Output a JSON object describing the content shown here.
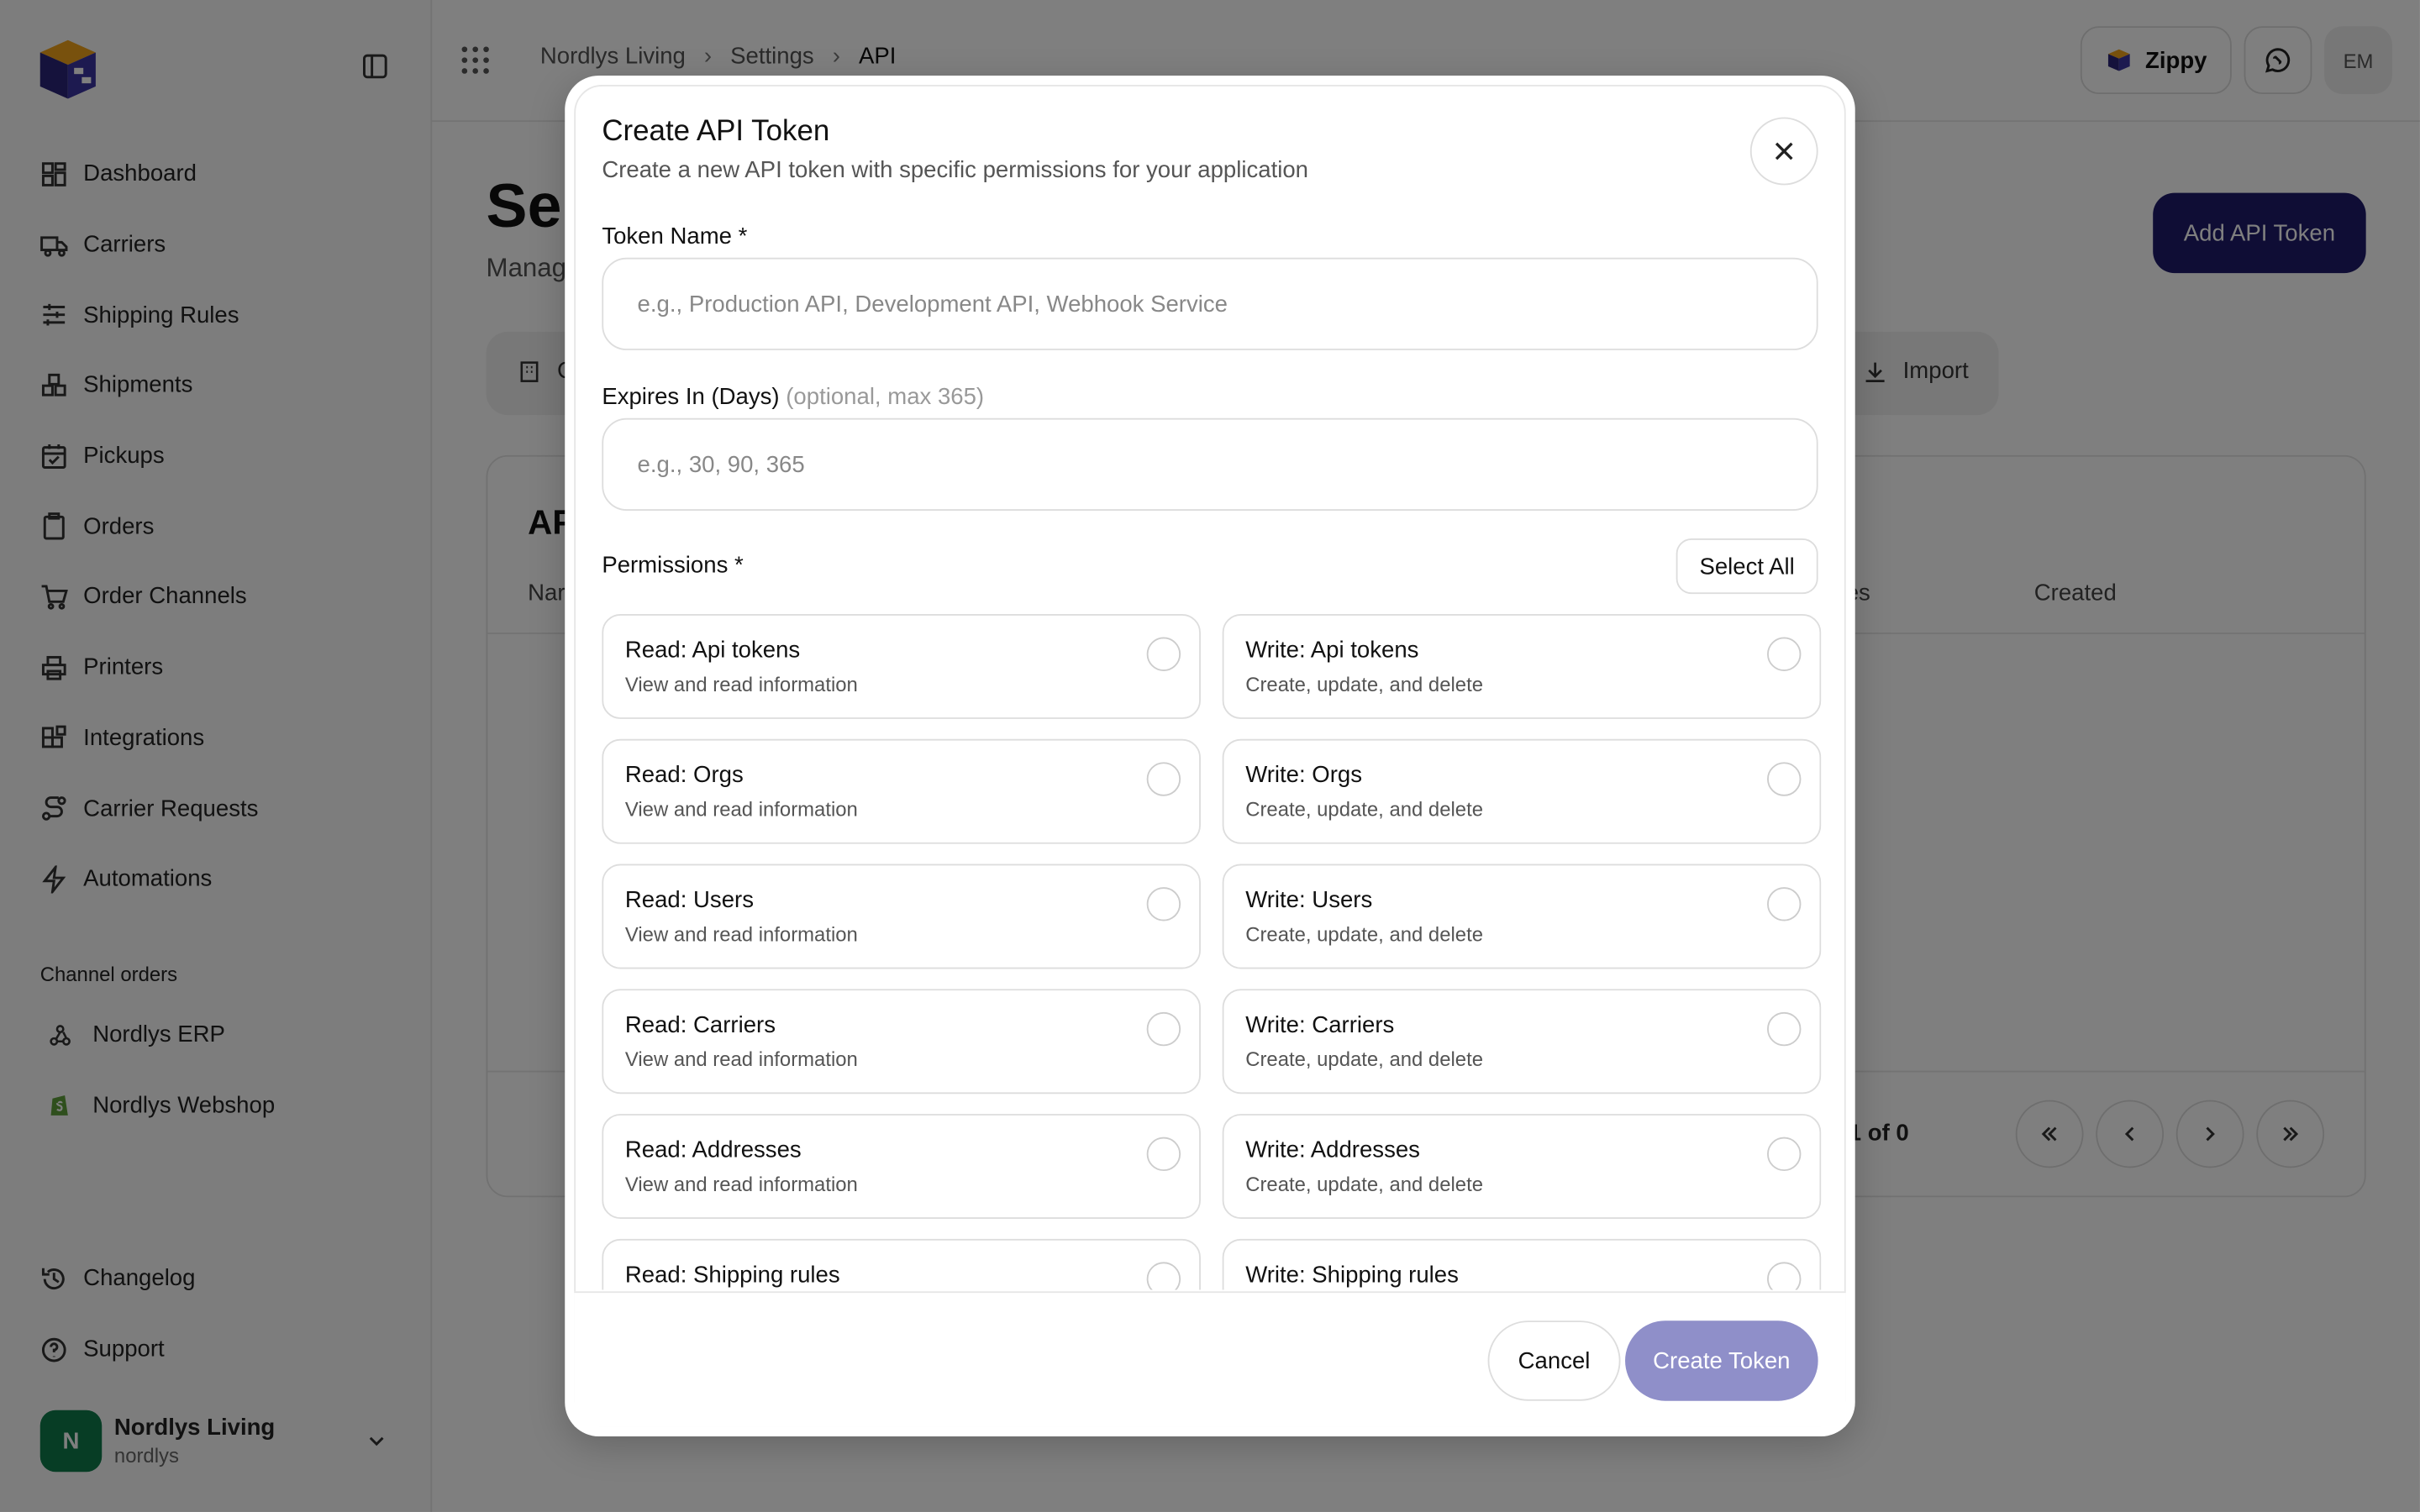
{
  "sidebar": {
    "items": [
      {
        "label": "Dashboard",
        "icon": "dashboard-icon"
      },
      {
        "label": "Carriers",
        "icon": "truck-icon"
      },
      {
        "label": "Shipping Rules",
        "icon": "sliders-icon"
      },
      {
        "label": "Shipments",
        "icon": "boxes-icon"
      },
      {
        "label": "Pickups",
        "icon": "calendar-icon"
      },
      {
        "label": "Orders",
        "icon": "clipboard-icon"
      },
      {
        "label": "Order Channels",
        "icon": "cart-icon"
      },
      {
        "label": "Printers",
        "icon": "printer-icon"
      },
      {
        "label": "Integrations",
        "icon": "blocks-icon"
      },
      {
        "label": "Carrier Requests",
        "icon": "route-icon"
      },
      {
        "label": "Automations",
        "icon": "zap-icon"
      }
    ],
    "channel_section_title": "Channel orders",
    "channels": [
      {
        "label": "Nordlys ERP",
        "icon": "webhook-icon"
      },
      {
        "label": "Nordlys Webshop",
        "icon": "shopify-icon"
      }
    ],
    "bottom_items": [
      {
        "label": "Changelog",
        "icon": "history-icon"
      },
      {
        "label": "Support",
        "icon": "help-icon"
      }
    ],
    "account": {
      "initial": "N",
      "name": "Nordlys Living",
      "slug": "nordlys"
    }
  },
  "header": {
    "breadcrumbs": [
      "Nordlys Living",
      "Settings",
      "API"
    ],
    "zippy_label": "Zippy",
    "user_initials": "EM"
  },
  "page": {
    "title": "Se",
    "subtitle": "Manag",
    "add_token_label": "Add API Token",
    "tab_first_partial": "C",
    "import_label": "Import",
    "table_title": "AP",
    "col_name_partial": "Nar",
    "col_expires_partial": "es",
    "col_created": "Created",
    "page_info_partial": "ge 1 of 0"
  },
  "modal": {
    "title": "Create API Token",
    "subtitle": "Create a new API token with specific permissions for your application",
    "token_name_label": "Token Name *",
    "token_name_placeholder": "e.g., Production API, Development API, Webhook Service",
    "token_name_value": "",
    "expires_label": "Expires In (Days)",
    "expires_hint": "(optional, max 365)",
    "expires_placeholder": "e.g., 30, 90, 365",
    "expires_value": "",
    "permissions_label": "Permissions *",
    "select_all_label": "Select All",
    "permissions": [
      {
        "title": "Read: Api tokens",
        "desc": "View and read information"
      },
      {
        "title": "Write: Api tokens",
        "desc": "Create, update, and delete"
      },
      {
        "title": "Read: Orgs",
        "desc": "View and read information"
      },
      {
        "title": "Write: Orgs",
        "desc": "Create, update, and delete"
      },
      {
        "title": "Read: Users",
        "desc": "View and read information"
      },
      {
        "title": "Write: Users",
        "desc": "Create, update, and delete"
      },
      {
        "title": "Read: Carriers",
        "desc": "View and read information"
      },
      {
        "title": "Write: Carriers",
        "desc": "Create, update, and delete"
      },
      {
        "title": "Read: Addresses",
        "desc": "View and read information"
      },
      {
        "title": "Write: Addresses",
        "desc": "Create, update, and delete"
      },
      {
        "title": "Read: Shipping rules",
        "desc": ""
      },
      {
        "title": "Write: Shipping rules",
        "desc": ""
      }
    ],
    "cancel_label": "Cancel",
    "create_label": "Create Token"
  },
  "colors": {
    "brand_navy": "#1e1b6b",
    "create_disabled": "#8f8fc9",
    "avatar_green": "#0f7a4b",
    "logo_orange": "#f0a21b"
  }
}
